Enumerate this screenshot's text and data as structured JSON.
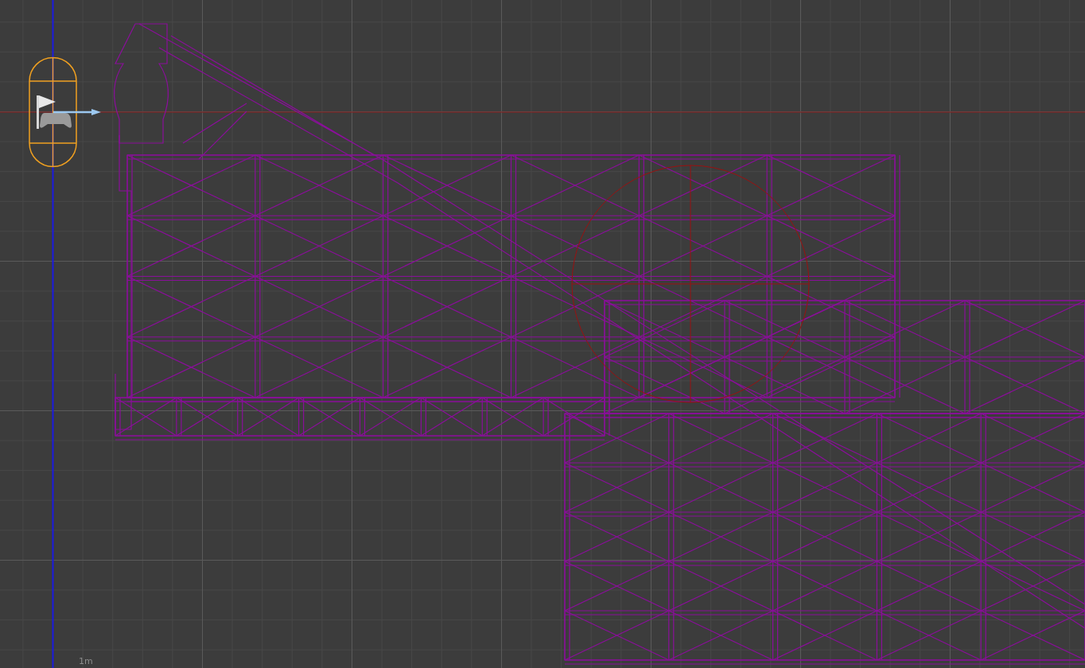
{
  "viewport": {
    "scale_label": "1m"
  }
}
